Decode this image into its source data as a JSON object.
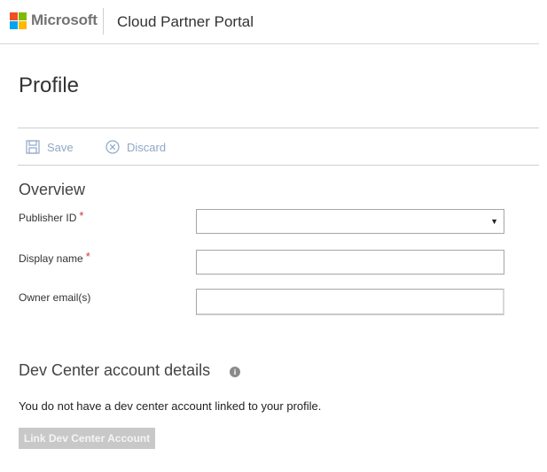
{
  "header": {
    "brand": "Microsoft",
    "portal_title": "Cloud Partner Portal"
  },
  "page": {
    "title": "Profile"
  },
  "toolbar": {
    "save_label": "Save",
    "discard_label": "Discard",
    "link_color": "#8fa7c7"
  },
  "overview": {
    "title": "Overview",
    "fields": [
      {
        "label": "Publisher ID",
        "required": true,
        "type": "select",
        "value": ""
      },
      {
        "label": "Display name",
        "required": true,
        "type": "text",
        "value": ""
      },
      {
        "label": "Owner email(s)",
        "required": false,
        "type": "text",
        "value": ""
      }
    ]
  },
  "dev_center": {
    "title": "Dev Center account details",
    "message": "You do not have a dev center account linked to your profile.",
    "button_label": "Link Dev Center Account"
  },
  "icons": {
    "logo": "microsoft-logo",
    "save": "save-icon",
    "discard": "discard-icon",
    "info": "info-icon",
    "dropdown": "chevron-down-icon"
  },
  "colors": {
    "required": "#d13438",
    "button_disabled_bg": "#c8c8c8"
  }
}
